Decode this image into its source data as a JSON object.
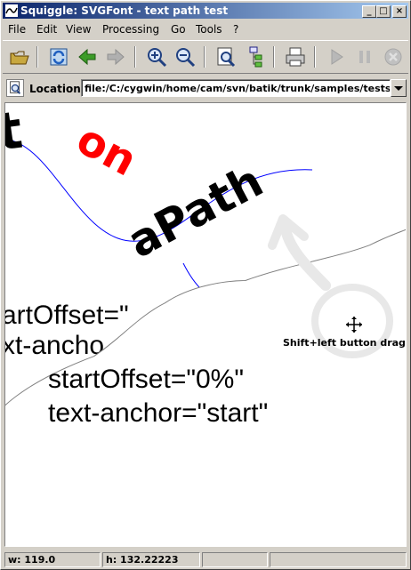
{
  "window": {
    "title": "Squiggle: SVGFont - text path test"
  },
  "title_buttons": {
    "minimize": "_",
    "maximize": "□",
    "close": "×"
  },
  "menu": [
    {
      "label": "File"
    },
    {
      "label": "Edit"
    },
    {
      "label": "View"
    },
    {
      "label": "Processing"
    },
    {
      "label": "Go"
    },
    {
      "label": "Tools"
    },
    {
      "label": "?"
    }
  ],
  "toolbar": {
    "icons": [
      "open-icon",
      "reload-icon",
      "back-icon",
      "forward-icon",
      "zoom-in-icon",
      "zoom-out-icon",
      "document-zoom-icon",
      "dom-tree-icon",
      "print-icon",
      "play-icon",
      "pause-icon",
      "stop-icon"
    ]
  },
  "location": {
    "label": "Location:",
    "value": "file:/C:/cygwin/home/cam/svn/batik/trunk/samples/tests/spec/"
  },
  "canvas": {
    "svg_text": {
      "t_letter": "t",
      "on_word": "on",
      "a_path": "aPath",
      "start_offset_partial": "artOffset=\"",
      "text_anchor_partial": "xt-ancho",
      "start_offset_full": "startOffset=\"0%\"",
      "text_anchor_full": "text-anchor=\"start\""
    },
    "hint": "Shift+left button drag",
    "colors": {
      "red": "#ff0000",
      "path_blue": "#0000ff"
    }
  },
  "status": {
    "width": "w: 119.0",
    "height": "h: 132.22223",
    "cell3": "",
    "cell4": ""
  }
}
